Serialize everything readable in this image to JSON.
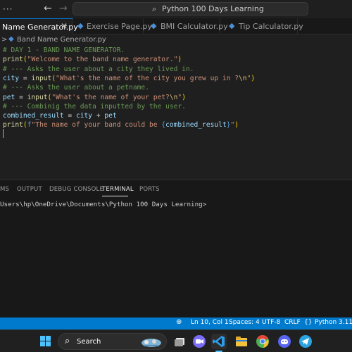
{
  "titlebar": {
    "menu_glyph": "···",
    "back_glyph": "←",
    "forward_glyph": "→",
    "search_glyph": "⌕",
    "command_center": "Python 100 Days Learning"
  },
  "tabs": [
    {
      "label": "Name Generator.py",
      "close": "✕",
      "active": true
    },
    {
      "label": "Exercise Page.py",
      "active": false
    },
    {
      "label": "BMI Calculator.py",
      "active": false
    },
    {
      "label": "Tip Calculator.py",
      "active": false
    }
  ],
  "breadcrumb": {
    "chevron": ">",
    "file": "Band Name Generator.py"
  },
  "editor": {
    "lines": [
      {
        "segments": [
          {
            "t": "# DAY 1 - BAND NAME GENERATOR.",
            "c": "c-comment"
          }
        ]
      },
      {
        "segments": [
          {
            "t": "print",
            "c": "c-func"
          },
          {
            "t": "(",
            "c": "c-paren"
          },
          {
            "t": "\"Welcome to the band name generator.\"",
            "c": "c-str"
          },
          {
            "t": ")",
            "c": "c-paren"
          }
        ]
      },
      {
        "segments": [
          {
            "t": "# --- Asks the user about a city they lived in.",
            "c": "c-comment"
          }
        ]
      },
      {
        "segments": [
          {
            "t": "city",
            "c": "c-var"
          },
          {
            "t": " = ",
            "c": "c-op"
          },
          {
            "t": "input",
            "c": "c-func"
          },
          {
            "t": "(",
            "c": "c-paren"
          },
          {
            "t": "\"What's the name of the city you grew up in ?",
            "c": "c-str"
          },
          {
            "t": "\\n",
            "c": "c-esc"
          },
          {
            "t": "\"",
            "c": "c-str"
          },
          {
            "t": ")",
            "c": "c-paren"
          }
        ]
      },
      {
        "segments": [
          {
            "t": "# --- Asks the user about a petname.",
            "c": "c-comment"
          }
        ]
      },
      {
        "segments": [
          {
            "t": "pet",
            "c": "c-var"
          },
          {
            "t": " = ",
            "c": "c-op"
          },
          {
            "t": "input",
            "c": "c-func"
          },
          {
            "t": "(",
            "c": "c-paren"
          },
          {
            "t": "\"What's the name of your pet?",
            "c": "c-str"
          },
          {
            "t": "\\n",
            "c": "c-esc"
          },
          {
            "t": "\"",
            "c": "c-str"
          },
          {
            "t": ")",
            "c": "c-paren"
          }
        ]
      },
      {
        "segments": [
          {
            "t": "# --- Combinig the data inputted by the user.",
            "c": "c-comment"
          }
        ]
      },
      {
        "segments": [
          {
            "t": "combined_result",
            "c": "c-var"
          },
          {
            "t": " = ",
            "c": "c-op"
          },
          {
            "t": "city",
            "c": "c-var"
          },
          {
            "t": " + ",
            "c": "c-op"
          },
          {
            "t": "pet",
            "c": "c-var"
          }
        ]
      },
      {
        "segments": [
          {
            "t": "print",
            "c": "c-func"
          },
          {
            "t": "(",
            "c": "c-paren"
          },
          {
            "t": "f",
            "c": "c-kw"
          },
          {
            "t": "\"The name of your band could be ",
            "c": "c-str"
          },
          {
            "t": "{",
            "c": "c-brace"
          },
          {
            "t": "combined_result",
            "c": "c-var"
          },
          {
            "t": "}",
            "c": "c-brace"
          },
          {
            "t": "\"",
            "c": "c-str"
          },
          {
            "t": ")",
            "c": "c-paren"
          }
        ]
      }
    ]
  },
  "panel": {
    "tabs": [
      {
        "label": "MS",
        "active": false
      },
      {
        "label": "OUTPUT",
        "active": false
      },
      {
        "label": "DEBUG CONSOLE",
        "active": false
      },
      {
        "label": "TERMINAL",
        "active": true
      },
      {
        "label": "PORTS",
        "active": false
      }
    ],
    "terminal_text": "Users\\hp\\OneDrive\\Documents\\Python 100 Days Learning>"
  },
  "statusbar": {
    "zoom_glyph": "⊕",
    "position": "Ln 10, Col 1",
    "spaces": "Spaces: 4",
    "encoding": "UTF-8",
    "eol": "CRLF",
    "braces_glyph": "{}",
    "language": "Python",
    "version": "3.11."
  },
  "taskbar": {
    "search_label": "Search",
    "search_glyph": "⌕",
    "apps": [
      {
        "name": "task-view-icon",
        "color": "#e6e6e6"
      },
      {
        "name": "zoom-icon",
        "color": "#7b6cf6"
      },
      {
        "name": "vscode-icon",
        "color": "#2f9ce8"
      },
      {
        "name": "file-explorer-icon",
        "color": "#f5c33b"
      },
      {
        "name": "chrome-icon",
        "color": "#4caf50"
      },
      {
        "name": "discord-icon",
        "color": "#5865f2"
      },
      {
        "name": "telegram-icon",
        "color": "#2aa3e0"
      }
    ]
  },
  "colors": {
    "accent": "#007acc",
    "editor_bg": "#1f1f1f",
    "panel_bg": "#181818"
  }
}
